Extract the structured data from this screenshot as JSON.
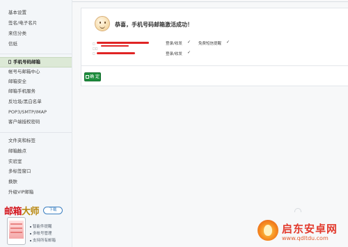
{
  "sidebar": {
    "items_top": [
      "基本设置",
      "签名/电子名片",
      "来信分类",
      "信纸"
    ],
    "active_item": "手机号码邮箱",
    "items_mid": [
      "帐号与邮箱中心",
      "邮箱安全",
      "邮箱手机服务",
      "反垃圾/黑白名单",
      "POP3/SMTP/IMAP",
      "客户端授权密码"
    ],
    "items_bottom": [
      "文件夹和标签",
      "邮箱触点",
      "实验室",
      "多标签窗口",
      "换肤",
      "升级VIP邮箱"
    ]
  },
  "promo": {
    "title_main": "邮箱",
    "title_accent": "大师",
    "download": "下载",
    "features": [
      "智能件提醒",
      "多帐号管理",
      "支持所有邮箱"
    ]
  },
  "main": {
    "success_message": "恭喜，手机号码邮箱激活成功！",
    "rows": [
      {
        "status": "登录/收发",
        "extra": "免费短信提醒"
      },
      {
        "status": "登录/收发",
        "extra": ""
      }
    ],
    "confirm_button": "确 定"
  },
  "watermark": {
    "brand": "启东安卓网",
    "url": "www.qdltdu.com"
  },
  "colors": {
    "active_bg": "#dce9d6",
    "confirm_green": "#1e8e3e",
    "redaction_red": "#e02424",
    "promo_red": "#d4141c"
  }
}
